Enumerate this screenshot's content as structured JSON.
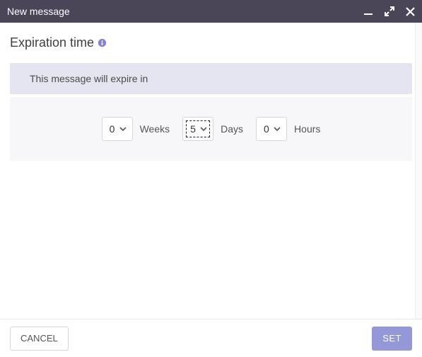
{
  "titlebar": {
    "title": "New message"
  },
  "page": {
    "heading": "Expiration time",
    "banner": "This message will expire in"
  },
  "picker": {
    "weeks": {
      "value": "0",
      "label": "Weeks"
    },
    "days": {
      "value": "5",
      "label": "Days"
    },
    "hours": {
      "value": "0",
      "label": "Hours"
    }
  },
  "buttons": {
    "cancel": "CANCEL",
    "set": "SET"
  }
}
